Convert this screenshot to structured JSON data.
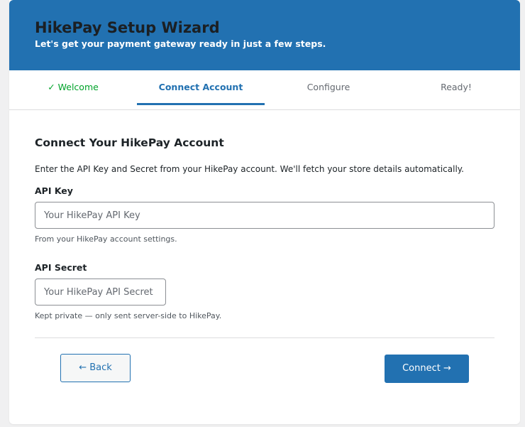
{
  "header": {
    "title": "HikePay Setup Wizard",
    "subtitle": "Let's get your payment gateway ready in just a few steps."
  },
  "steps": [
    {
      "label": "✓ Welcome",
      "state": "done"
    },
    {
      "label": "Connect Account",
      "state": "active"
    },
    {
      "label": "Configure",
      "state": "pending"
    },
    {
      "label": "Ready!",
      "state": "pending"
    }
  ],
  "form": {
    "title": "Connect Your HikePay Account",
    "intro": "Enter the API Key and Secret from your HikePay account. We'll fetch your store details automatically.",
    "api_key": {
      "label": "API Key",
      "value": "",
      "placeholder": "Your HikePay API Key",
      "hint": "From your HikePay account settings."
    },
    "api_secret": {
      "label": "API Secret",
      "value": "",
      "placeholder": "Your HikePay API Secret",
      "hint": "Kept private — only sent server-side to HikePay."
    }
  },
  "actions": {
    "back_label": "← Back",
    "connect_label": "Connect →"
  },
  "colors": {
    "accent": "#2271b1",
    "done": "#00a32a",
    "muted": "#646970"
  }
}
